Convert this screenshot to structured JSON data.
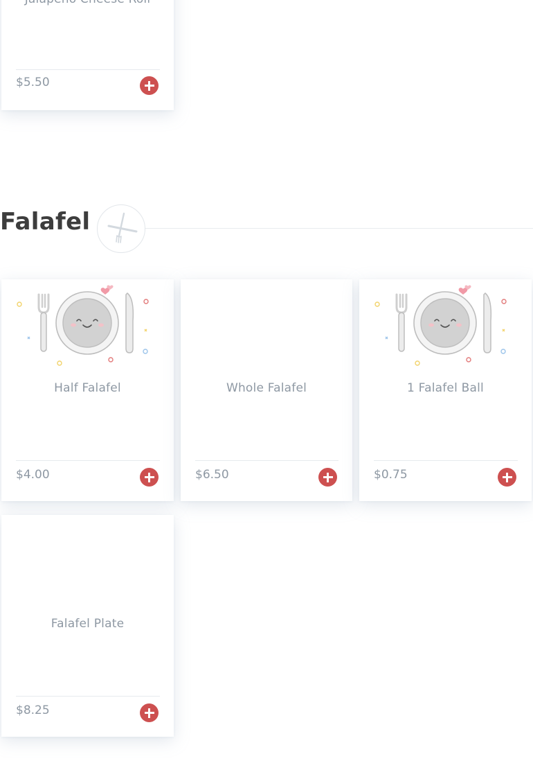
{
  "prev_card": {
    "name": "Jalapeño Cheese Roll",
    "price": "$5.50"
  },
  "section": {
    "title": "Falafel",
    "icon": "fork-knife-icon"
  },
  "items": [
    {
      "name": "Half Falafel",
      "price": "$4.00",
      "image": "plate-placeholder-illustration"
    },
    {
      "name": "Whole Falafel",
      "price": "$6.50",
      "image": ""
    },
    {
      "name": "1 Falafel Ball",
      "price": "$0.75",
      "image": "plate-placeholder-illustration"
    },
    {
      "name": "Falafel Plate",
      "price": "$8.25",
      "image": ""
    }
  ],
  "colors": {
    "accent": "#cd5050",
    "text_muted": "#8e98a3",
    "heading": "#3d3d3d"
  }
}
